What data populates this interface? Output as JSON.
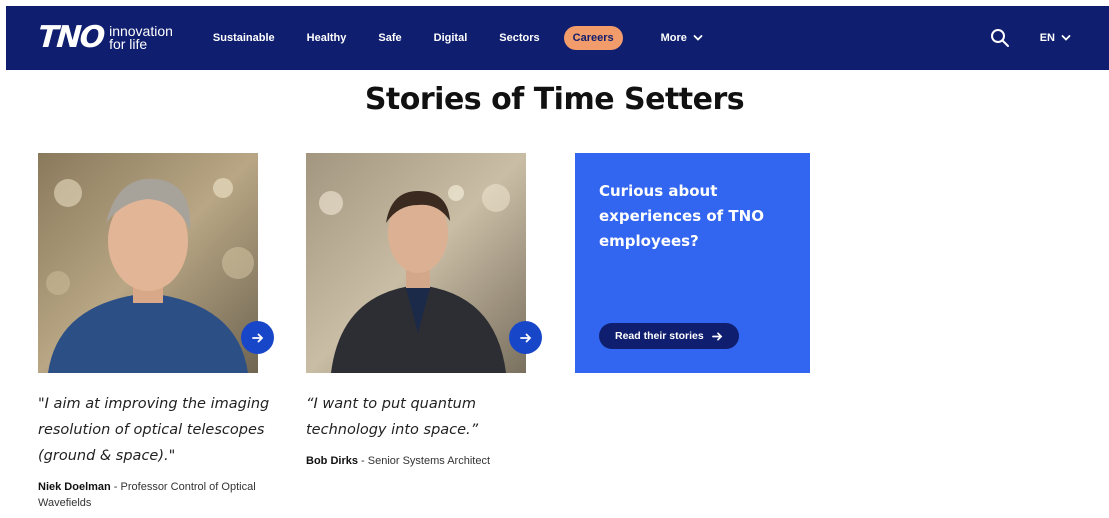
{
  "header": {
    "logo_mark": "TNO",
    "logo_tagline_1": "innovation",
    "logo_tagline_2": "for life",
    "nav": {
      "sustainable": "Sustainable",
      "healthy": "Healthy",
      "safe": "Safe",
      "digital": "Digital",
      "sectors": "Sectors",
      "careers": "Careers",
      "more": "More"
    },
    "language": "EN",
    "colors": {
      "bar": "#0f1e6e",
      "careers_pill": "#f29b6b"
    }
  },
  "main": {
    "title": "Stories of Time Setters",
    "stories": [
      {
        "quote": "\"I aim at improving the imaging resolution of optical telescopes (ground & space).\"",
        "name": "Niek Doelman",
        "role": " - Professor Control of Optical Wavefields"
      },
      {
        "quote": "“I want to put quantum technology into space.”",
        "name": "Bob Dirks",
        "role": " - Senior Systems Architect"
      }
    ],
    "cta": {
      "text": "Curious about experiences of TNO employees?",
      "button": "Read their stories",
      "color": "#3366f0"
    }
  }
}
